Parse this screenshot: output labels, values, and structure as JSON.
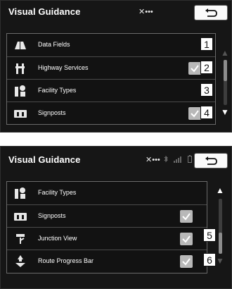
{
  "screen1": {
    "title": "Visual Guidance",
    "status": "✕•••",
    "rows": [
      {
        "label": "Data Fields",
        "icon": "data-fields-icon",
        "checked": false
      },
      {
        "label": "Highway Services",
        "icon": "highway-services-icon",
        "checked": true
      },
      {
        "label": "Facility Types",
        "icon": "facility-types-icon",
        "checked": false
      },
      {
        "label": "Signposts",
        "icon": "signposts-icon",
        "checked": true
      }
    ],
    "callouts": [
      "1",
      "2",
      "3",
      "4"
    ],
    "scroll_up": "▲",
    "scroll_down": "▼"
  },
  "screen2": {
    "title": "Visual Guidance",
    "status": "✕•••",
    "rows": [
      {
        "label": "Facility Types",
        "icon": "facility-types-icon",
        "checked": false
      },
      {
        "label": "Signposts",
        "icon": "signposts-icon",
        "checked": true
      },
      {
        "label": "Junction View",
        "icon": "junction-view-icon",
        "checked": true
      },
      {
        "label": "Route Progress Bar",
        "icon": "route-progress-bar-icon",
        "checked": true
      }
    ],
    "callouts": [
      "5",
      "6"
    ],
    "scroll_up": "▲",
    "scroll_down": "▼"
  },
  "colors": {
    "background": "#161616",
    "text": "#ffffff",
    "checkbox": "#b8b8b8",
    "divider": "#4a4a4a"
  }
}
